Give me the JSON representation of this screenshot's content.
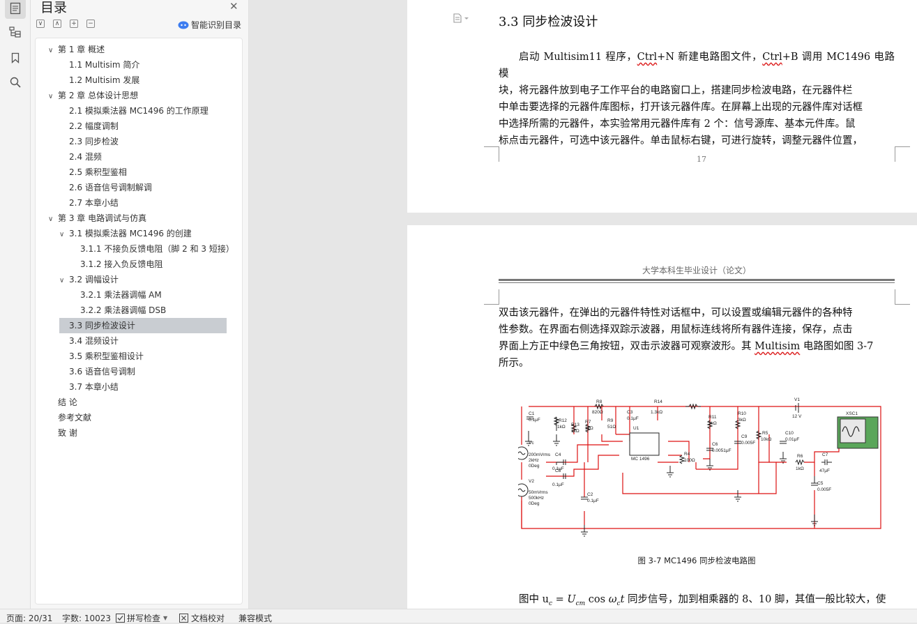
{
  "sidebar": {
    "title": "目录",
    "smart_toc": "智能识别目录",
    "toolbar": [
      "∨",
      "∧",
      "+",
      "−"
    ],
    "items": [
      {
        "label": "第 1 章  概述",
        "level": 1,
        "expanded": true
      },
      {
        "label": "1.1 Multisim 简介",
        "level": 2
      },
      {
        "label": "1.2 Multisim 发展",
        "level": 2
      },
      {
        "label": "第 2 章  总体设计思想",
        "level": 1,
        "expanded": true
      },
      {
        "label": "2.1  模拟乘法器 MC1496 的工作原理",
        "level": 2
      },
      {
        "label": "2.2  幅度调制",
        "level": 2
      },
      {
        "label": "2.3  同步检波",
        "level": 2
      },
      {
        "label": "2.4  混频",
        "level": 2
      },
      {
        "label": "2.5  乘积型鉴相",
        "level": 2
      },
      {
        "label": "2.6  语音信号调制解调",
        "level": 2
      },
      {
        "label": "2.7  本章小结",
        "level": 2
      },
      {
        "label": "第 3 章  电路调试与仿真",
        "level": 1,
        "expanded": true
      },
      {
        "label": "3.1  模拟乘法器 MC1496 的创建",
        "level": 2,
        "expanded": true
      },
      {
        "label": "3.1.1  不接负反馈电阻（脚 2 和 3 短接）",
        "level": 3
      },
      {
        "label": "3.1.2  接入负反馈电阻",
        "level": 3
      },
      {
        "label": "3.2  调幅设计",
        "level": 2,
        "expanded": true
      },
      {
        "label": "3.2.1  乘法器调幅 AM",
        "level": 3
      },
      {
        "label": "3.2.2  乘法器调幅 DSB",
        "level": 3
      },
      {
        "label": "3.3  同步检波设计",
        "level": 2,
        "selected": true
      },
      {
        "label": "3.4  混频设计",
        "level": 2
      },
      {
        "label": "3.5  乘积型鉴相设计",
        "level": 2
      },
      {
        "label": "3.6  语音信号调制",
        "level": 2
      },
      {
        "label": "3.7  本章小结",
        "level": 2
      },
      {
        "label": "结  论",
        "level": 1
      },
      {
        "label": "参考文献",
        "level": 1
      },
      {
        "label": "致  谢",
        "level": 1
      }
    ]
  },
  "doc": {
    "heading": "3.3  同步检波设计",
    "para1_lines": [
      "启动 Multisim11 程序，Ctrl+N 新建电路图文件，Ctrl+B 调用 MC1496 电路模",
      "块，将元器件放到电子工作平台的电路窗口上，搭建同步检波电路，在元器件栏",
      "中单击要选择的元器件库图标，打开该元器件库。在屏幕上出现的元器件库对话框",
      "中选择所需的元器件，本实验常用元器件库有 2 个：信号源库、基本元件库。鼠",
      "标点击元器件，可选中该元器件。单击鼠标右键，可进行旋转，调整元器件位置，"
    ],
    "page_number": "17",
    "running_header": "大学本科生毕业设计（论文）",
    "para2_lines": [
      "双击该元器件，在弹出的元器件特性对话框中，可以设置或编辑元器件的各种特",
      "性参数。在界面右侧选择双踪示波器，用鼠标连线将所有器件连接，保存，点击",
      "界面上方正中绿色三角按钮，双击示波器可观察波形。其 Multisim 电路图如图 3-7",
      "所示。"
    ],
    "figure_caption": "图 3-7   MC1496 同步检波电路图",
    "para3": "图中 u",
    "para3_rest": " 同步信号，加到相乘器的 8、10 脚，其值一般比较大，使",
    "circuit_labels": {
      "c1": "C1",
      "c1v": "0.1μF",
      "r8": "R8",
      "r8v": "820Ω",
      "r14": "R14",
      "r14v": "1.3kΩ",
      "r12": "R12",
      "r12v": "1kΩ",
      "r13": "R13",
      "r13v": "1kΩ",
      "r7": "R7",
      "r7v": "1kΩ",
      "r9": "R9",
      "r9v": "51Ω",
      "c3": "C3",
      "c3v": "0.1μF",
      "u1": "U1",
      "mc": "MC 1496",
      "r11": "R11",
      "r11v": "3kΩ",
      "r10": "R10",
      "r10v": "3kΩ",
      "v1": "V1",
      "v1v": "12 V",
      "xsc": "XSC1",
      "c6": "C6",
      "c6v": "0.0051μF",
      "c9": "C9",
      "c9v": "0.005F",
      "r5": "R5",
      "r5v": "10kΩ",
      "c10": "C10",
      "c10v": "0.01μF",
      "r4": "R4",
      "r4v": "100Ω",
      "r6": "R6",
      "r6v": "1kΩ",
      "c7": "C7",
      "c7v": "47μF",
      "c5": "C5",
      "c5v": "0.005F",
      "c4": "C4",
      "c4v": "0.1μF",
      "c8": "C8",
      "c8v": "0.1μF",
      "c2": "C2",
      "c2v": "0.1μF",
      "vc": "Vc",
      "vcv1": "200mVrms",
      "vcv2": "2kHz",
      "vcv3": "0Deg",
      "v2": "V2",
      "v2v1": "50mVrms",
      "v2v2": "500kHz",
      "v2v3": "0Deg"
    }
  },
  "status": {
    "page": "页面: 20/31",
    "words": "字数: 10023",
    "spell": "拼写检查",
    "proof": "文档校对",
    "compat": "兼容模式"
  }
}
